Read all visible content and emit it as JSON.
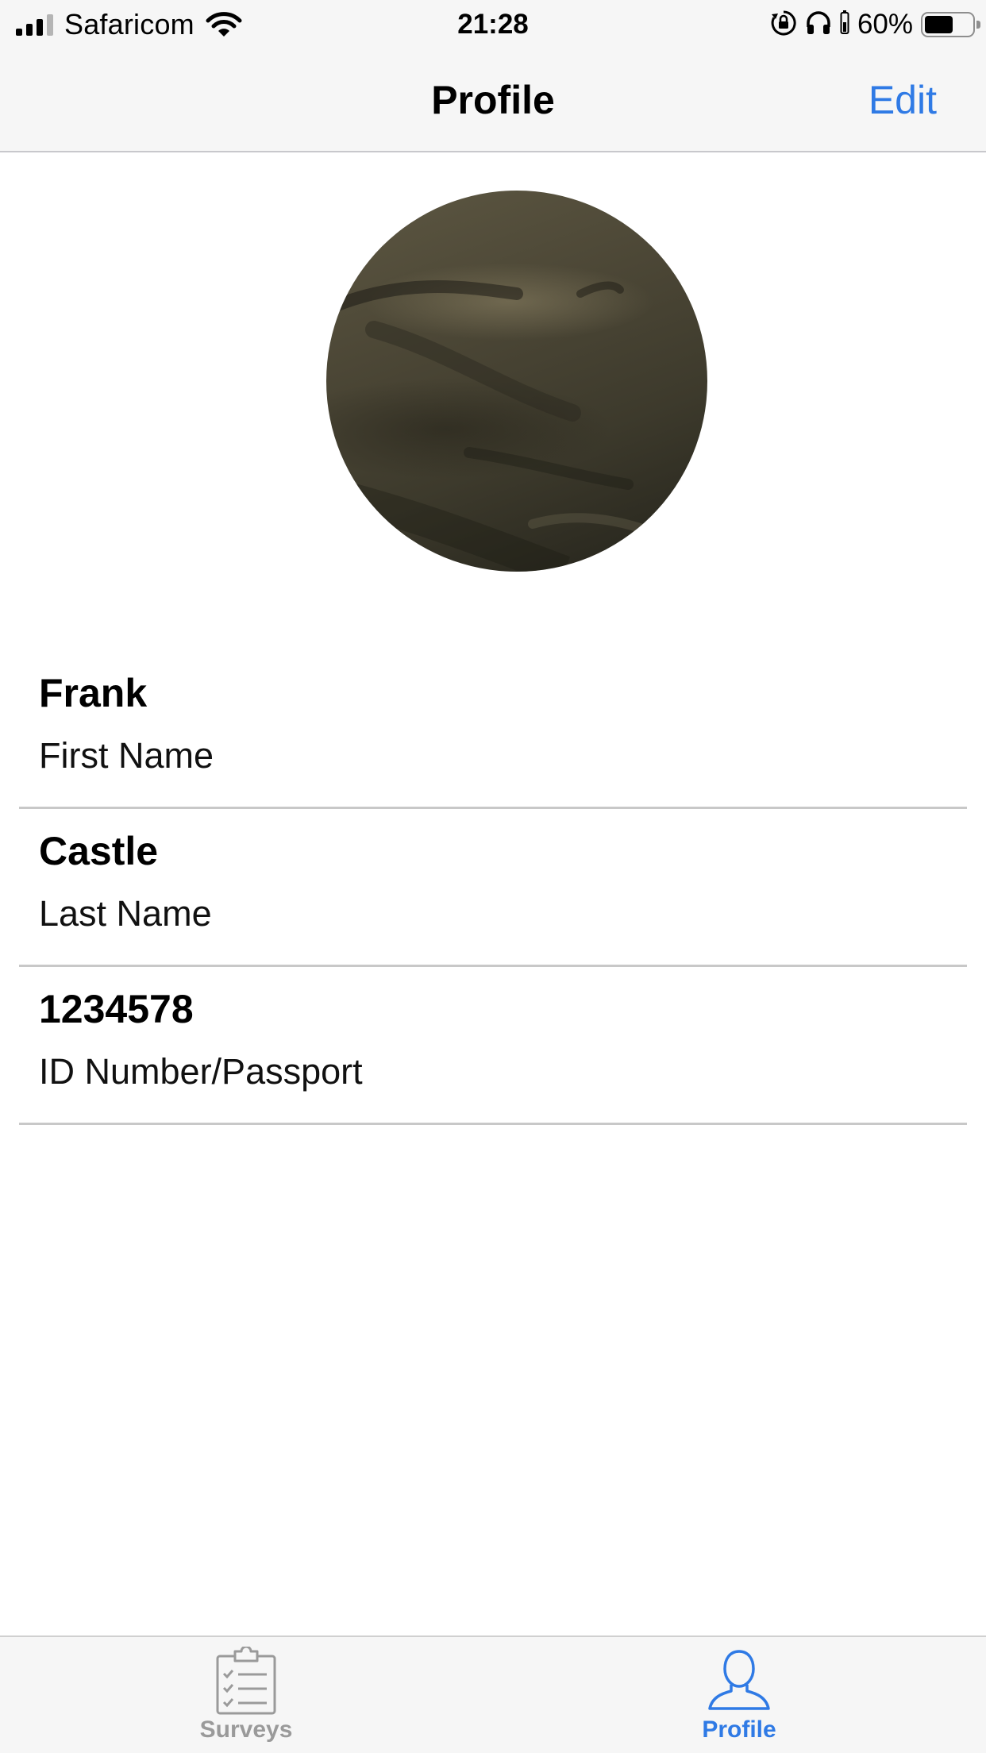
{
  "status_bar": {
    "carrier": "Safaricom",
    "time": "21:28",
    "battery_percent": "60%",
    "battery_level": 0.6,
    "signal_bars": 3,
    "icons": [
      "signal-icon",
      "wifi-icon",
      "orientation-lock-icon",
      "headphones-icon",
      "headphone-battery-icon",
      "battery-icon"
    ]
  },
  "nav": {
    "title": "Profile",
    "edit_label": "Edit"
  },
  "profile": {
    "avatar": "profile-photo",
    "fields": [
      {
        "value": "Frank",
        "label": "First Name"
      },
      {
        "value": "Castle",
        "label": "Last Name"
      },
      {
        "value": "1234578",
        "label": "ID Number/Passport"
      }
    ]
  },
  "tab_bar": {
    "tabs": [
      {
        "label": "Surveys",
        "icon": "clipboard-checklist-icon",
        "selected": false
      },
      {
        "label": "Profile",
        "icon": "person-icon",
        "selected": true
      }
    ]
  },
  "colors": {
    "accent": "#2f7ae5",
    "bar_background": "#f6f6f6",
    "separator": "#c8c8c8",
    "inactive_tab": "#9a9a9a"
  }
}
